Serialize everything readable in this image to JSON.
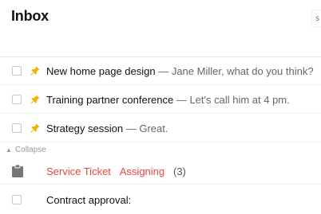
{
  "header": {
    "title": "Inbox",
    "search_placeholder": "s"
  },
  "tasks": [
    {
      "title": "New home page design",
      "note": " — Jane Miller, what do you think?"
    },
    {
      "title": "Training partner conference",
      "note": " — Let's call him at 4 pm."
    },
    {
      "title": "Strategy session",
      "note": " — Great."
    }
  ],
  "collapse_label": "Collapse",
  "service": {
    "label": "Service Ticket",
    "status": "Assigning",
    "count": "(3)"
  },
  "last_task": {
    "title": "Contract approval:"
  },
  "colors": {
    "accent_red": "#e8453c",
    "pin_yellow": "#f4b400"
  },
  "icons": {
    "pin": "pin-icon",
    "clipboard": "clipboard-icon",
    "collapse": "triangle-up-icon"
  }
}
